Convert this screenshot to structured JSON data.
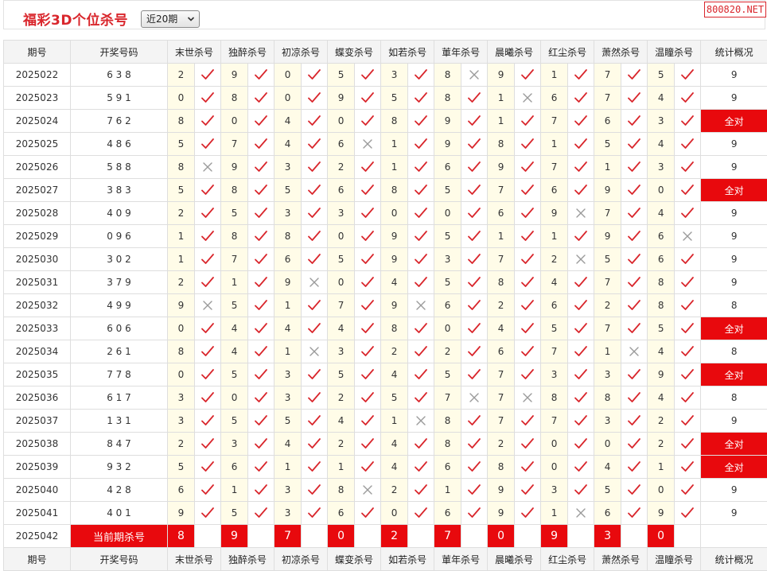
{
  "header": {
    "title": "福彩3D个位杀号",
    "period_select": "近20期",
    "site_badge": "800820.NET"
  },
  "table": {
    "columns": [
      "期号",
      "开奖号码",
      "末世杀号",
      "独醉杀号",
      "初凉杀号",
      "蝶变杀号",
      "如若杀号",
      "莗年杀号",
      "晨曦杀号",
      "红尘杀号",
      "萧然杀号",
      "温瞳杀号",
      "统计概况"
    ],
    "rows": [
      {
        "issue": "2025022",
        "draw": "6 3 8",
        "kills": [
          [
            "2",
            1
          ],
          [
            "9",
            1
          ],
          [
            "0",
            1
          ],
          [
            "5",
            1
          ],
          [
            "3",
            1
          ],
          [
            "8",
            0
          ],
          [
            "9",
            1
          ],
          [
            "1",
            1
          ],
          [
            "7",
            1
          ],
          [
            "5",
            1
          ]
        ],
        "stat": "9"
      },
      {
        "issue": "2025023",
        "draw": "5 9 1",
        "kills": [
          [
            "0",
            1
          ],
          [
            "8",
            1
          ],
          [
            "0",
            1
          ],
          [
            "9",
            1
          ],
          [
            "5",
            1
          ],
          [
            "8",
            1
          ],
          [
            "1",
            0
          ],
          [
            "6",
            1
          ],
          [
            "7",
            1
          ],
          [
            "4",
            1
          ]
        ],
        "stat": "9"
      },
      {
        "issue": "2025024",
        "draw": "7 6 2",
        "kills": [
          [
            "8",
            1
          ],
          [
            "0",
            1
          ],
          [
            "4",
            1
          ],
          [
            "0",
            1
          ],
          [
            "8",
            1
          ],
          [
            "9",
            1
          ],
          [
            "1",
            1
          ],
          [
            "7",
            1
          ],
          [
            "6",
            1
          ],
          [
            "3",
            1
          ]
        ],
        "stat": "全对"
      },
      {
        "issue": "2025025",
        "draw": "4 8 6",
        "kills": [
          [
            "5",
            1
          ],
          [
            "7",
            1
          ],
          [
            "4",
            1
          ],
          [
            "6",
            0
          ],
          [
            "1",
            1
          ],
          [
            "9",
            1
          ],
          [
            "8",
            1
          ],
          [
            "1",
            1
          ],
          [
            "5",
            1
          ],
          [
            "4",
            1
          ]
        ],
        "stat": "9"
      },
      {
        "issue": "2025026",
        "draw": "5 8 8",
        "kills": [
          [
            "8",
            0
          ],
          [
            "9",
            1
          ],
          [
            "3",
            1
          ],
          [
            "2",
            1
          ],
          [
            "1",
            1
          ],
          [
            "6",
            1
          ],
          [
            "9",
            1
          ],
          [
            "7",
            1
          ],
          [
            "1",
            1
          ],
          [
            "3",
            1
          ]
        ],
        "stat": "9"
      },
      {
        "issue": "2025027",
        "draw": "3 8 3",
        "kills": [
          [
            "5",
            1
          ],
          [
            "8",
            1
          ],
          [
            "5",
            1
          ],
          [
            "6",
            1
          ],
          [
            "8",
            1
          ],
          [
            "5",
            1
          ],
          [
            "7",
            1
          ],
          [
            "6",
            1
          ],
          [
            "9",
            1
          ],
          [
            "0",
            1
          ]
        ],
        "stat": "全对"
      },
      {
        "issue": "2025028",
        "draw": "4 0 9",
        "kills": [
          [
            "2",
            1
          ],
          [
            "5",
            1
          ],
          [
            "3",
            1
          ],
          [
            "3",
            1
          ],
          [
            "0",
            1
          ],
          [
            "0",
            1
          ],
          [
            "6",
            1
          ],
          [
            "9",
            0
          ],
          [
            "7",
            1
          ],
          [
            "4",
            1
          ]
        ],
        "stat": "9"
      },
      {
        "issue": "2025029",
        "draw": "0 9 6",
        "kills": [
          [
            "1",
            1
          ],
          [
            "8",
            1
          ],
          [
            "8",
            1
          ],
          [
            "0",
            1
          ],
          [
            "9",
            1
          ],
          [
            "5",
            1
          ],
          [
            "1",
            1
          ],
          [
            "1",
            1
          ],
          [
            "9",
            1
          ],
          [
            "6",
            0
          ]
        ],
        "stat": "9"
      },
      {
        "issue": "2025030",
        "draw": "3 0 2",
        "kills": [
          [
            "1",
            1
          ],
          [
            "7",
            1
          ],
          [
            "6",
            1
          ],
          [
            "5",
            1
          ],
          [
            "9",
            1
          ],
          [
            "3",
            1
          ],
          [
            "7",
            1
          ],
          [
            "2",
            0
          ],
          [
            "5",
            1
          ],
          [
            "6",
            1
          ]
        ],
        "stat": "9"
      },
      {
        "issue": "2025031",
        "draw": "3 7 9",
        "kills": [
          [
            "2",
            1
          ],
          [
            "1",
            1
          ],
          [
            "9",
            0
          ],
          [
            "0",
            1
          ],
          [
            "4",
            1
          ],
          [
            "5",
            1
          ],
          [
            "8",
            1
          ],
          [
            "4",
            1
          ],
          [
            "7",
            1
          ],
          [
            "8",
            1
          ]
        ],
        "stat": "9"
      },
      {
        "issue": "2025032",
        "draw": "4 9 9",
        "kills": [
          [
            "9",
            0
          ],
          [
            "5",
            1
          ],
          [
            "1",
            1
          ],
          [
            "7",
            1
          ],
          [
            "9",
            0
          ],
          [
            "6",
            1
          ],
          [
            "2",
            1
          ],
          [
            "6",
            1
          ],
          [
            "2",
            1
          ],
          [
            "8",
            1
          ]
        ],
        "stat": "8"
      },
      {
        "issue": "2025033",
        "draw": "6 0 6",
        "kills": [
          [
            "0",
            1
          ],
          [
            "4",
            1
          ],
          [
            "4",
            1
          ],
          [
            "4",
            1
          ],
          [
            "8",
            1
          ],
          [
            "0",
            1
          ],
          [
            "4",
            1
          ],
          [
            "5",
            1
          ],
          [
            "7",
            1
          ],
          [
            "5",
            1
          ]
        ],
        "stat": "全对"
      },
      {
        "issue": "2025034",
        "draw": "2 6 1",
        "kills": [
          [
            "8",
            1
          ],
          [
            "4",
            1
          ],
          [
            "1",
            0
          ],
          [
            "3",
            1
          ],
          [
            "2",
            1
          ],
          [
            "2",
            1
          ],
          [
            "6",
            1
          ],
          [
            "7",
            1
          ],
          [
            "1",
            0
          ],
          [
            "4",
            1
          ]
        ],
        "stat": "8"
      },
      {
        "issue": "2025035",
        "draw": "7 7 8",
        "kills": [
          [
            "0",
            1
          ],
          [
            "5",
            1
          ],
          [
            "3",
            1
          ],
          [
            "5",
            1
          ],
          [
            "4",
            1
          ],
          [
            "5",
            1
          ],
          [
            "7",
            1
          ],
          [
            "3",
            1
          ],
          [
            "3",
            1
          ],
          [
            "9",
            1
          ]
        ],
        "stat": "全对"
      },
      {
        "issue": "2025036",
        "draw": "6 1 7",
        "kills": [
          [
            "3",
            1
          ],
          [
            "0",
            1
          ],
          [
            "3",
            1
          ],
          [
            "2",
            1
          ],
          [
            "5",
            1
          ],
          [
            "7",
            0
          ],
          [
            "7",
            0
          ],
          [
            "8",
            1
          ],
          [
            "8",
            1
          ],
          [
            "4",
            1
          ]
        ],
        "stat": "8"
      },
      {
        "issue": "2025037",
        "draw": "1 3 1",
        "kills": [
          [
            "3",
            1
          ],
          [
            "5",
            1
          ],
          [
            "5",
            1
          ],
          [
            "4",
            1
          ],
          [
            "1",
            0
          ],
          [
            "8",
            1
          ],
          [
            "7",
            1
          ],
          [
            "7",
            1
          ],
          [
            "3",
            1
          ],
          [
            "2",
            1
          ]
        ],
        "stat": "9"
      },
      {
        "issue": "2025038",
        "draw": "8 4 7",
        "kills": [
          [
            "2",
            1
          ],
          [
            "3",
            1
          ],
          [
            "4",
            1
          ],
          [
            "2",
            1
          ],
          [
            "4",
            1
          ],
          [
            "8",
            1
          ],
          [
            "2",
            1
          ],
          [
            "0",
            1
          ],
          [
            "0",
            1
          ],
          [
            "2",
            1
          ]
        ],
        "stat": "全对"
      },
      {
        "issue": "2025039",
        "draw": "9 3 2",
        "kills": [
          [
            "5",
            1
          ],
          [
            "6",
            1
          ],
          [
            "1",
            1
          ],
          [
            "1",
            1
          ],
          [
            "4",
            1
          ],
          [
            "6",
            1
          ],
          [
            "8",
            1
          ],
          [
            "0",
            1
          ],
          [
            "4",
            1
          ],
          [
            "1",
            1
          ]
        ],
        "stat": "全对"
      },
      {
        "issue": "2025040",
        "draw": "4 2 8",
        "kills": [
          [
            "6",
            1
          ],
          [
            "1",
            1
          ],
          [
            "3",
            1
          ],
          [
            "8",
            0
          ],
          [
            "2",
            1
          ],
          [
            "1",
            1
          ],
          [
            "9",
            1
          ],
          [
            "3",
            1
          ],
          [
            "5",
            1
          ],
          [
            "0",
            1
          ]
        ],
        "stat": "9"
      },
      {
        "issue": "2025041",
        "draw": "4 0 1",
        "kills": [
          [
            "9",
            1
          ],
          [
            "5",
            1
          ],
          [
            "3",
            1
          ],
          [
            "6",
            1
          ],
          [
            "0",
            1
          ],
          [
            "6",
            1
          ],
          [
            "9",
            1
          ],
          [
            "1",
            0
          ],
          [
            "6",
            1
          ],
          [
            "9",
            1
          ]
        ],
        "stat": "9"
      }
    ],
    "current": {
      "issue": "2025042",
      "label": "当前期杀号",
      "kills": [
        "8",
        "9",
        "7",
        "0",
        "2",
        "7",
        "0",
        "9",
        "3",
        "0"
      ]
    }
  },
  "colors": {
    "accent": "#e8090d",
    "check": "#d9262c",
    "cross": "#9a9a9a",
    "value_bg": "#fffce8",
    "header_bg": "#f4f4f4"
  },
  "icons": {
    "hit": "check-icon",
    "miss": "cross-icon"
  }
}
